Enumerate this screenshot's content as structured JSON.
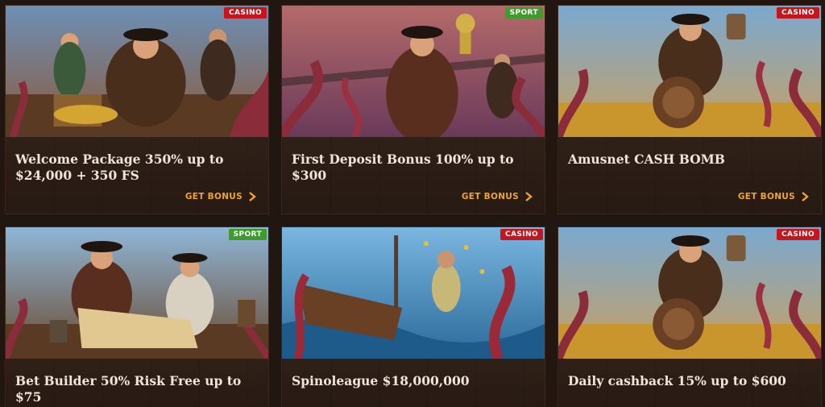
{
  "cards": [
    {
      "badge": "CASINO",
      "title": "Welcome Package 350% up to $24,000 + 350 FS",
      "cta": "GET BONUS"
    },
    {
      "badge": "SPORT",
      "title": "First Deposit Bonus 100% up to $300",
      "cta": "GET BONUS"
    },
    {
      "badge": "CASINO",
      "title": "Amusnet CASH BOMB",
      "cta": "GET BONUS"
    },
    {
      "badge": "SPORT",
      "title": "Bet Builder 50% Risk Free up to $75"
    },
    {
      "badge": "CASINO",
      "title": "Spinoleague $18,000,000"
    },
    {
      "badge": "CASINO",
      "title": "Daily cashback 15% up to $600"
    }
  ],
  "colors": {
    "casino_badge": "#c4161c",
    "sport_badge": "#3d9c2b",
    "cta": "#f0a52a"
  }
}
